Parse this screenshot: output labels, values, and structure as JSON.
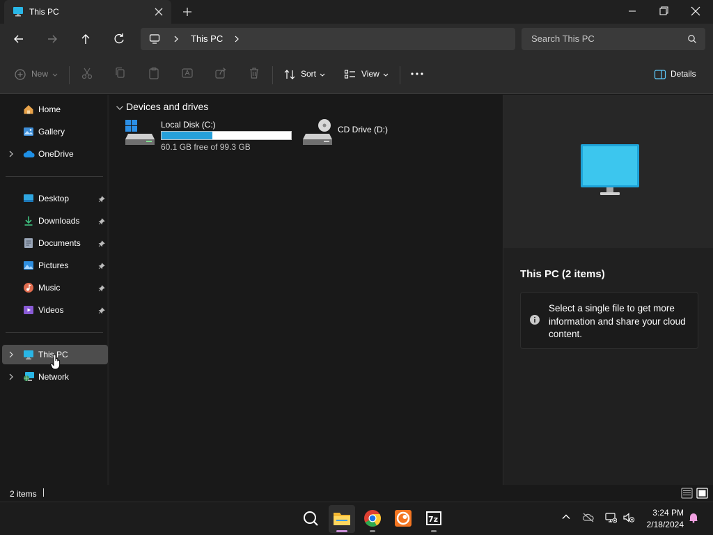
{
  "window": {
    "tab_title": "This PC",
    "new_tab": "+",
    "controls": [
      "minimize",
      "restore",
      "close"
    ]
  },
  "nav": {
    "address_segments": [
      "This PC"
    ],
    "search_placeholder": "Search This PC"
  },
  "toolbar": {
    "new_label": "New",
    "sort_label": "Sort",
    "view_label": "View",
    "details_label": "Details"
  },
  "sidebar": {
    "top": [
      {
        "label": "Home",
        "icon": "home-icon"
      },
      {
        "label": "Gallery",
        "icon": "gallery-icon"
      },
      {
        "label": "OneDrive",
        "icon": "onedrive-icon"
      }
    ],
    "pinned": [
      {
        "label": "Desktop",
        "icon": "desktop-icon"
      },
      {
        "label": "Downloads",
        "icon": "downloads-icon"
      },
      {
        "label": "Documents",
        "icon": "documents-icon"
      },
      {
        "label": "Pictures",
        "icon": "pictures-icon"
      },
      {
        "label": "Music",
        "icon": "music-icon"
      },
      {
        "label": "Videos",
        "icon": "videos-icon"
      }
    ],
    "bottom": [
      {
        "label": "This PC",
        "icon": "this-pc-icon",
        "selected": true
      },
      {
        "label": "Network",
        "icon": "network-icon"
      }
    ]
  },
  "main": {
    "section_title": "Devices and drives",
    "drives": [
      {
        "name": "Local Disk (C:)",
        "subtitle": "60.1 GB free of 99.3 GB",
        "used_fraction": 0.395
      },
      {
        "name": "CD Drive (D:)"
      }
    ]
  },
  "details": {
    "title": "This PC (2 items)",
    "info": "Select a single file to get more information and share your cloud content."
  },
  "status": {
    "item_count": "2 items"
  },
  "taskbar": {
    "apps": [
      "search-icon",
      "file-explorer-icon",
      "chrome-icon",
      "crunchyroll-icon",
      "7zip-icon"
    ],
    "time": "3:24 PM",
    "date": "2/18/2024"
  },
  "colors": {
    "accent": "#26a0da",
    "selected_bg": "#4d4d4d"
  }
}
